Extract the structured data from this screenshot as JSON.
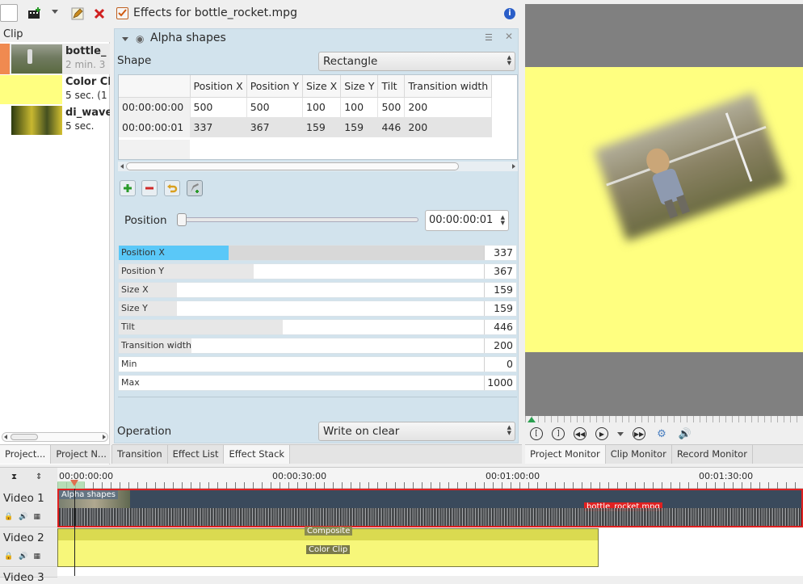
{
  "bin": {
    "header": "Clip",
    "clips": [
      {
        "name": "bottle_",
        "duration": "2 min. 3",
        "thumb": "photo"
      },
      {
        "name": "Color Cl",
        "duration": "5 sec. (1",
        "thumb": "yellow"
      },
      {
        "name": "di_wave",
        "duration": "5 sec.",
        "thumb": "photo2"
      }
    ],
    "tabs": [
      "Project...",
      "Project N..."
    ]
  },
  "effects": {
    "title": "Effects for bottle_rocket.mpg",
    "effect_name": "Alpha shapes",
    "shape_label": "Shape",
    "shape_value": "Rectangle",
    "table": {
      "columns": [
        "",
        "Position X",
        "Position Y",
        "Size X",
        "Size Y",
        "Tilt",
        "Transition width"
      ],
      "rows": [
        [
          "00:00:00:00",
          "500",
          "500",
          "100",
          "100",
          "500",
          "200"
        ],
        [
          "00:00:00:01",
          "337",
          "367",
          "159",
          "159",
          "446",
          "200"
        ]
      ]
    },
    "position_label": "Position",
    "position_value": "00:00:00:01",
    "params": [
      {
        "label": "Position X",
        "value": "337",
        "fill": 0.3,
        "active": true
      },
      {
        "label": "Position Y",
        "value": "367",
        "fill": 0.37
      },
      {
        "label": "Size X",
        "value": "159",
        "fill": 0.16
      },
      {
        "label": "Size Y",
        "value": "159",
        "fill": 0.16
      },
      {
        "label": "Tilt",
        "value": "446",
        "fill": 0.45
      },
      {
        "label": "Transition width",
        "value": "200",
        "fill": 0.2
      },
      {
        "label": "Min",
        "value": "0",
        "fill": 0
      },
      {
        "label": "Max",
        "value": "1000",
        "fill": 0
      }
    ],
    "operation_label": "Operation",
    "operation_value": "Write on clear",
    "tabs": [
      "Transition",
      "Effect List",
      "Effect Stack"
    ]
  },
  "monitor": {
    "tabs": [
      "Project Monitor",
      "Clip Monitor",
      "Record Monitor"
    ]
  },
  "timeline": {
    "ruler": [
      "00:00:00:00",
      "00:00:30:00",
      "00:01:00:00",
      "00:01:30:00"
    ],
    "tracks": [
      {
        "name": "Video 1"
      },
      {
        "name": "Video 2"
      },
      {
        "name": "Video 3"
      }
    ],
    "clip_effect_label": "Alpha shapes",
    "clip_name": "bottle_rocket.mpg",
    "composite_label": "Composite",
    "color_clip_label": "Color Clip"
  },
  "colors": {
    "accent": "#4a90d9",
    "yellow": "#ffff80",
    "track_yellow": "#f4f46a",
    "selection_red": "#e02020"
  }
}
